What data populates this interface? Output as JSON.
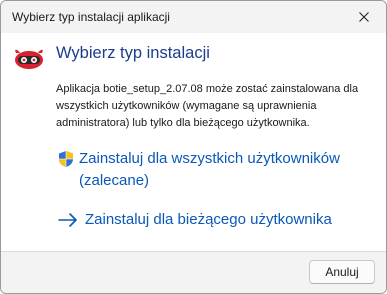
{
  "window": {
    "title": "Wybierz typ instalacji aplikacji"
  },
  "main": {
    "heading": "Wybierz typ instalacji",
    "description": "Aplikacja botie_setup_2.07.08 może zostać zainstalowana dla wszystkich użytkowników (wymagane są uprawnienia administratora) lub tylko dla bieżącego użytkownika.",
    "option_all_users": {
      "line1": "Zainstaluj dla wszystkich użytkowników",
      "line2": "(zalecane)",
      "icon": "uac-shield-icon"
    },
    "option_current_user": {
      "label": "Zainstaluj dla bieżącego użytkownika",
      "icon": "arrow-right-icon"
    }
  },
  "footer": {
    "cancel_label": "Anuluj"
  },
  "colors": {
    "heading": "#1c3c8c",
    "link": "#0a58b8",
    "titlebar_bg": "#f3f3f3",
    "footer_bg": "#f3f3f3"
  }
}
